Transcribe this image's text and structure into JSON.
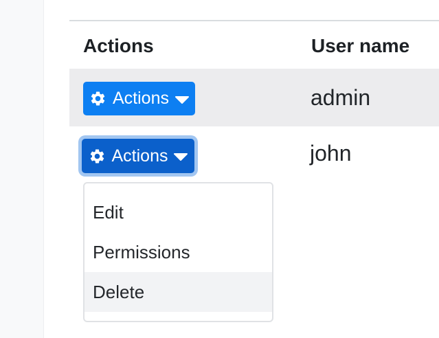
{
  "colors": {
    "primary": "#0d7ff2",
    "primary_active": "#0b60cb",
    "focus_ring": "#a2c6f1",
    "row_stripe": "#ececee",
    "menu_hover": "#f2f3f5",
    "sidebar_bg": "#f8f9fa",
    "border": "#d9dcdf",
    "text": "#212529"
  },
  "table": {
    "headers": [
      {
        "label": "Actions"
      },
      {
        "label": "User name"
      }
    ],
    "rows": [
      {
        "username": "admin",
        "actions_label": "Actions",
        "state": "default"
      },
      {
        "username": "john",
        "actions_label": "Actions",
        "state": "menu-open-focused"
      }
    ]
  },
  "action_menu": {
    "items": [
      {
        "label": "Edit",
        "hovered": false
      },
      {
        "label": "Permissions",
        "hovered": false
      },
      {
        "label": "Delete",
        "hovered": true
      }
    ]
  }
}
